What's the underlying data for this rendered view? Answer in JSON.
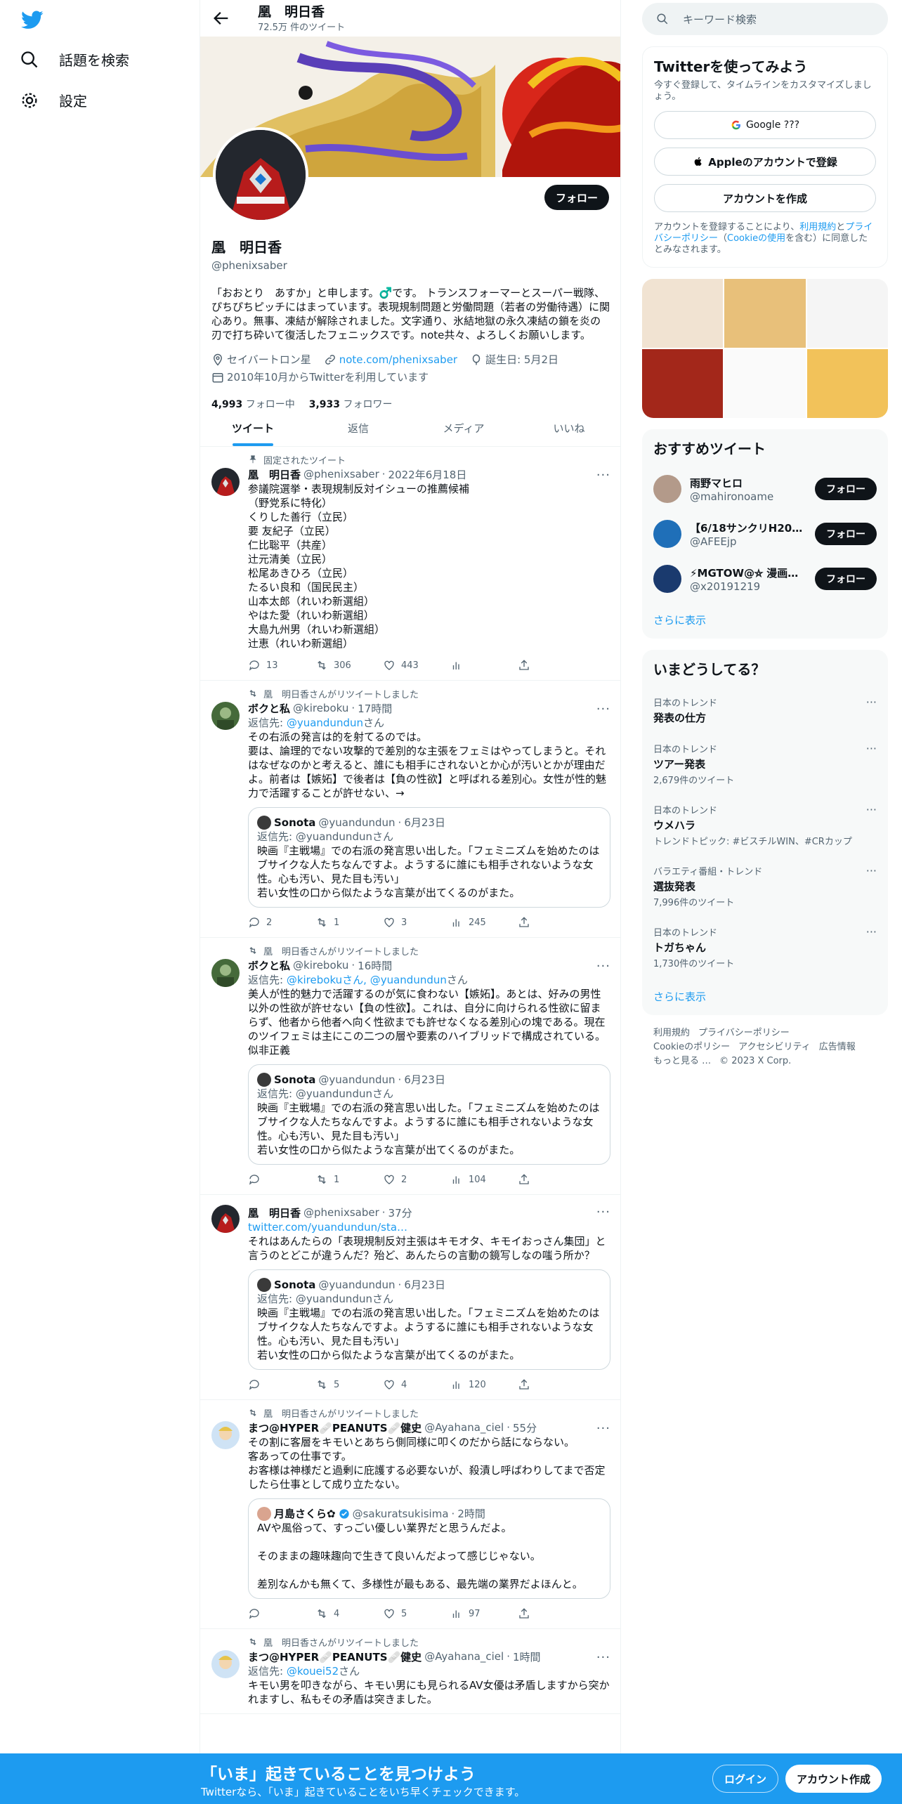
{
  "nav": {
    "explore": "話題を検索",
    "settings": "設定"
  },
  "header": {
    "name": "凰　明日香",
    "tweet_count": "72.5万 件のツイート",
    "follow": "フォロー"
  },
  "profile": {
    "name": "凰　明日香",
    "handle": "@phenixsaber",
    "bio": "「おおとり　あすか」と申します。♂️です。 トランスフォーマーとスーパー戦隊、ぴちぴちピッチにはまっています。表現規制問題と労働問題（若者の労働待遇）に関心あり。無事、凍結が解除されました。文字通り、氷結地獄の永久凍結の鎖を炎の刃で打ち砕いて復活したフェニックスです。note共々、よろしくお願いします。",
    "location": "セイバートロン星",
    "link": "note.com/phenixsaber",
    "birthday": "誕生日: 5月2日",
    "joined": "2010年10月からTwitterを利用しています",
    "following_count": "4,993",
    "following_label": "フォロー中",
    "followers_count": "3,933",
    "followers_label": "フォロワー"
  },
  "tabs": [
    "ツイート",
    "返信",
    "メディア",
    "いいね"
  ],
  "tweets": [
    {
      "context": "固定されたツイート",
      "name": "凰　明日香",
      "handle": "@phenixsaber",
      "time": "2022年6月18日",
      "body": "参議院選挙・表現規制反対イシューの推薦候補\n（野党系に特化）\nくりした善行（立民）\n要 友紀子（立民）\n仁比聡平（共産）\n辻元清美（立民）\n松尾あきひろ（立民）\nたるい良和（国民民主）\n山本太郎（れいわ新選組）\nやはた愛（れいわ新選組）\n大島九州男（れいわ新選組）\n辻恵（れいわ新選組）",
      "replies": "13",
      "retweets": "306",
      "likes": "443",
      "views": ""
    },
    {
      "context": "凰　明日香さんがリツイートしました",
      "name": "ボクと私",
      "handle": "@kireboku",
      "time": "17時間",
      "reply_prefix": "返信先: ",
      "reply_to": "@yuandundun",
      "reply_suffix": "さん",
      "body": "その右派の発言は的を射てるのでは。\n要は、論理的でない攻撃的で差別的な主張をフェミはやってしまうと。それはなぜなのかと考えると、誰にも相手にされないとか心が汚いとかが理由だよ。前者は【嫉妬】で後者は【負の性欲】と呼ばれる差別心。女性が性的魅力で活躍することが許せない、→",
      "quote": {
        "name": "Sonota",
        "handle": "@yuandundun",
        "time": "6月23日",
        "reply": "返信先: @yuandundunさん",
        "body": "映画『主戦場』での右派の発言思い出した。「フェミニズムを始めたのはブサイクな人たちなんですよ。ようするに誰にも相手されないような女性。心も汚い、見た目も汚い」\n若い女性の口から似たような言葉が出てくるのがまた。"
      },
      "replies": "2",
      "retweets": "1",
      "likes": "3",
      "views": "245"
    },
    {
      "context": "凰　明日香さんがリツイートしました",
      "name": "ボクと私",
      "handle": "@kireboku",
      "time": "16時間",
      "reply_prefix": "返信先: ",
      "reply_to": "@kirebokuさん, @yuandundun",
      "reply_suffix": "さん",
      "body": "美人が性的魅力で活躍するのが気に食わない【嫉妬】。あとは、好みの男性以外の性欲が許せない【負の性欲】。これは、自分に向けられる性欲に留まらず、他者から他者へ向く性欲までも許せなくなる差別心の塊である。現在のツイフェミは主にこの二つの層や要素のハイブリッドで構成されている。似非正義",
      "quote": {
        "name": "Sonota",
        "handle": "@yuandundun",
        "time": "6月23日",
        "reply": "返信先: @yuandundunさん",
        "body": "映画『主戦場』での右派の発言思い出した。「フェミニズムを始めたのはブサイクな人たちなんですよ。ようするに誰にも相手されないような女性。心も汚い、見た目も汚い」\n若い女性の口から似たような言葉が出てくるのがまた。"
      },
      "replies": "",
      "retweets": "1",
      "likes": "2",
      "views": "104"
    },
    {
      "context": "",
      "name": "凰　明日香",
      "handle": "@phenixsaber",
      "time": "37分",
      "link": "twitter.com/yuandundun/sta…",
      "body": "それはあんたらの「表現規制反対主張はキモオタ、キモイおっさん集団」と言うのとどこが違うんだ？殆ど、あんたらの言動の鏡写しなの嗤う所か？",
      "quote": {
        "name": "Sonota",
        "handle": "@yuandundun",
        "time": "6月23日",
        "reply": "返信先: @yuandundunさん",
        "body": "映画『主戦場』での右派の発言思い出した。「フェミニズムを始めたのはブサイクな人たちなんですよ。ようするに誰にも相手されないような女性。心も汚い、見た目も汚い」\n若い女性の口から似たような言葉が出てくるのがまた。"
      },
      "replies": "",
      "retweets": "5",
      "likes": "4",
      "views": "120"
    },
    {
      "context": "凰　明日香さんがリツイートしました",
      "name": "まつ@HYPER🩹PEANUTS🩹健史",
      "handle": "@Ayahana_ciel",
      "time": "55分",
      "body": "その割に客層をキモいとあちら側同様に叩くのだから話にならない。\n客あっての仕事です。\nお客様は神様だと過剰に庇護する必要ないが、殺漬し呼ばわりしてまで否定したら仕事として成り立たない。",
      "quote": {
        "name": "月島さくら✿",
        "handle": "@sakuratsukisima",
        "time": "2時間",
        "reply": "",
        "body": "AVや風俗って、すっごい優しい業界だと思うんだよ。\n\nそのままの趣味趣向で生きて良いんだよって感じじゃない。\n\n差別なんかも無くて、多様性が最もある、最先端の業界だよほんと。"
      },
      "replies": "",
      "retweets": "4",
      "likes": "5",
      "views": "97"
    },
    {
      "context": "凰　明日香さんがリツイートしました",
      "name": "まつ@HYPER🩹PEANUTS🩹健史",
      "handle": "@Ayahana_ciel",
      "time": "1時間",
      "reply_prefix": "返信先: ",
      "reply_to": "@kouei52",
      "reply_suffix": "さん",
      "body": "キモい男を叩きながら、キモい男にも見られるAV女優は矛盾しますから突かれますし、私もその矛盾は突きました。"
    }
  ],
  "right": {
    "search_placeholder": "キーワード検索",
    "signup_title": "Twitterを使ってみよう",
    "signup_sub": "今すぐ登録して、タイムラインをカスタマイズしましょう。",
    "google": "Google ???",
    "apple": "Appleのアカウントで登録",
    "create": "アカウントを作成",
    "fine_pre": "アカウントを登録することにより、",
    "terms": "利用規約",
    "and": "と",
    "privacy": "プライバシーポリシー",
    "cookie_open": "（",
    "cookie": "Cookieの使用",
    "fine_post": "を含む）に同意したとみなされます。",
    "recommend_title": "おすすめツイート",
    "recommend": [
      {
        "name": "雨野マヒロ",
        "handle": "@mahironoame"
      },
      {
        "name": "【6/18サンクリH20b…",
        "handle": "@AFEEjp"
      },
      {
        "name": "⚡MGTOW@⛥ 漫画…",
        "handle": "@x20191219"
      }
    ],
    "follow": "フォロー",
    "show_more": "さらに表示",
    "trends_title": "いまどうしてる？",
    "trends": [
      {
        "cat": "日本のトレンド",
        "title": "発表の仕方",
        "sub": ""
      },
      {
        "cat": "日本のトレンド",
        "title": "ツアー発表",
        "sub": "2,679件のツイート"
      },
      {
        "cat": "日本のトレンド",
        "title": "ウメハラ",
        "sub": "トレンドトピック: #ビスチルWIN、#CRカップ"
      },
      {
        "cat": "バラエティ番組・トレンド",
        "title": "選抜発表",
        "sub": "7,996件のツイート"
      },
      {
        "cat": "日本のトレンド",
        "title": "トガちゃん",
        "sub": "1,730件のツイート"
      }
    ],
    "footer": [
      "利用規約",
      "プライバシーポリシー",
      "Cookieのポリシー",
      "アクセシビリティ",
      "広告情報",
      "もっと見る …",
      "© 2023 X Corp."
    ]
  },
  "bottom": {
    "title": "「いま」起きていることを見つけよう",
    "sub": "Twitterなら、「いま」起きていることをいち早くチェックできます。",
    "login": "ログイン",
    "register": "アカウント作成"
  },
  "colors": {
    "accent": "#1d9bf0",
    "text": "#0f1419",
    "muted": "#536471"
  }
}
